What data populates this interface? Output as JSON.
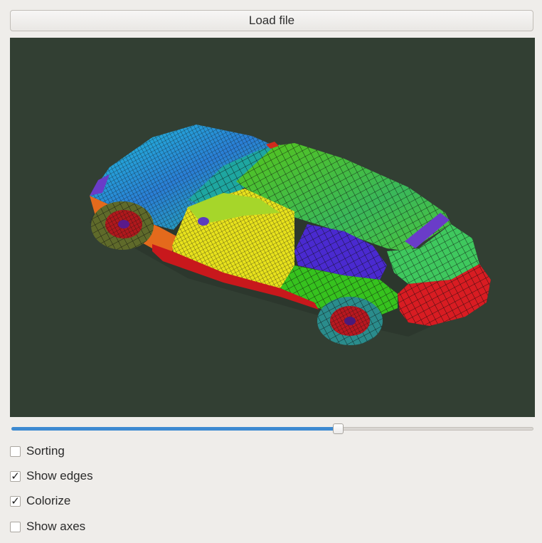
{
  "toolbar": {
    "load_label": "Load file"
  },
  "viewport": {
    "background_color": "#323f33",
    "content": "car-wireframe-mesh"
  },
  "slider": {
    "value_fraction": 0.625
  },
  "options": [
    {
      "label": "Sorting",
      "checked": false
    },
    {
      "label": "Show edges",
      "checked": true
    },
    {
      "label": "Colorize",
      "checked": true
    },
    {
      "label": "Show axes",
      "checked": false
    }
  ],
  "colors": {
    "accent": "#3d8ad1",
    "window_bg": "#efedea"
  }
}
